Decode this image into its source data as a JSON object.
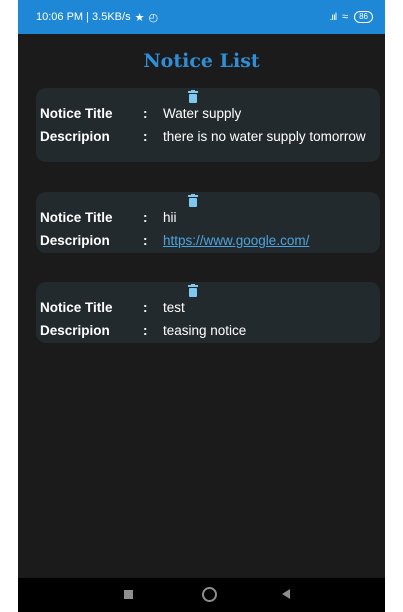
{
  "status_bar": {
    "time": "10:06 PM | 3.5KB/s",
    "battery": "86"
  },
  "page": {
    "title": "Notice List"
  },
  "labels": {
    "notice_title": "Notice Title",
    "description": "Descripion",
    "colon": ":"
  },
  "notices": [
    {
      "title": "Water supply",
      "description": "there is no water supply tomorrow"
    },
    {
      "title": "hii",
      "description": "https://www.google.com/"
    },
    {
      "title": "test",
      "description": "teasing notice"
    }
  ],
  "colors": {
    "status_bar": "#1e88d6",
    "background": "#1b1b1b",
    "card": "#232a2d",
    "accent": "#2f8ed6",
    "trash_icon": "#7fc8f0"
  },
  "icons": {
    "delete": "trash-icon",
    "nav_recents": "square-icon",
    "nav_home": "circle-icon",
    "nav_back": "triangle-back-icon"
  }
}
